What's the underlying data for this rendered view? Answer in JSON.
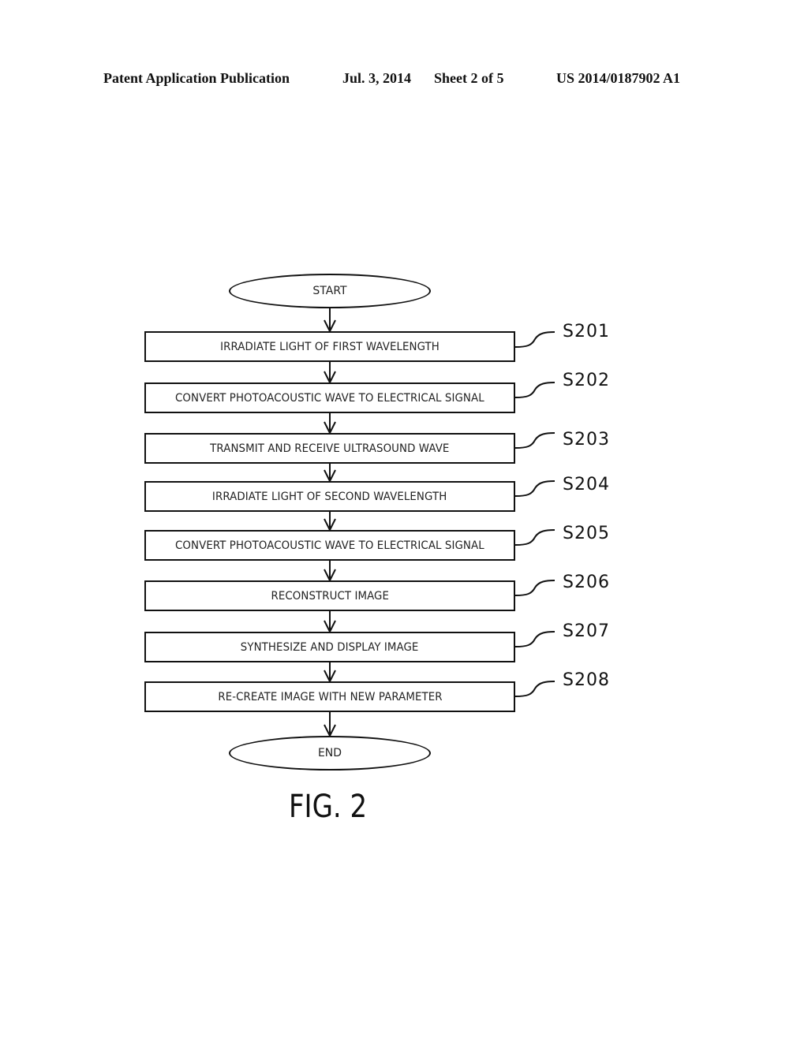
{
  "header": {
    "publication": "Patent Application Publication",
    "date": "Jul. 3, 2014",
    "sheet": "Sheet 2 of 5",
    "number": "US 2014/0187902 A1"
  },
  "flowchart": {
    "start": "START",
    "end": "END",
    "steps": [
      {
        "id": "S201",
        "text": "IRRADIATE LIGHT OF FIRST WAVELENGTH"
      },
      {
        "id": "S202",
        "text": "CONVERT PHOTOACOUSTIC WAVE TO ELECTRICAL SIGNAL"
      },
      {
        "id": "S203",
        "text": "TRANSMIT AND RECEIVE ULTRASOUND WAVE"
      },
      {
        "id": "S204",
        "text": "IRRADIATE LIGHT OF SECOND WAVELENGTH"
      },
      {
        "id": "S205",
        "text": "CONVERT PHOTOACOUSTIC WAVE TO ELECTRICAL SIGNAL"
      },
      {
        "id": "S206",
        "text": "RECONSTRUCT IMAGE"
      },
      {
        "id": "S207",
        "text": "SYNTHESIZE AND DISPLAY IMAGE"
      },
      {
        "id": "S208",
        "text": "RE-CREATE IMAGE WITH NEW PARAMETER"
      }
    ]
  },
  "figure_label": "FIG. 2"
}
